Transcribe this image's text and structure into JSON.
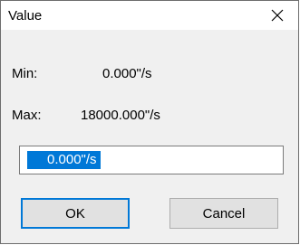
{
  "window": {
    "title": "Value"
  },
  "min": {
    "label": "Min:",
    "value": "0.000\"/s"
  },
  "max": {
    "label": "Max:",
    "value": "18000.000\"/s"
  },
  "input": {
    "value": "0.000\"/s"
  },
  "buttons": {
    "ok": "OK",
    "cancel": "Cancel"
  },
  "colors": {
    "accent": "#0078d7",
    "dialog_bg": "#f0f0f0"
  },
  "icons": {
    "close": "close-icon"
  }
}
